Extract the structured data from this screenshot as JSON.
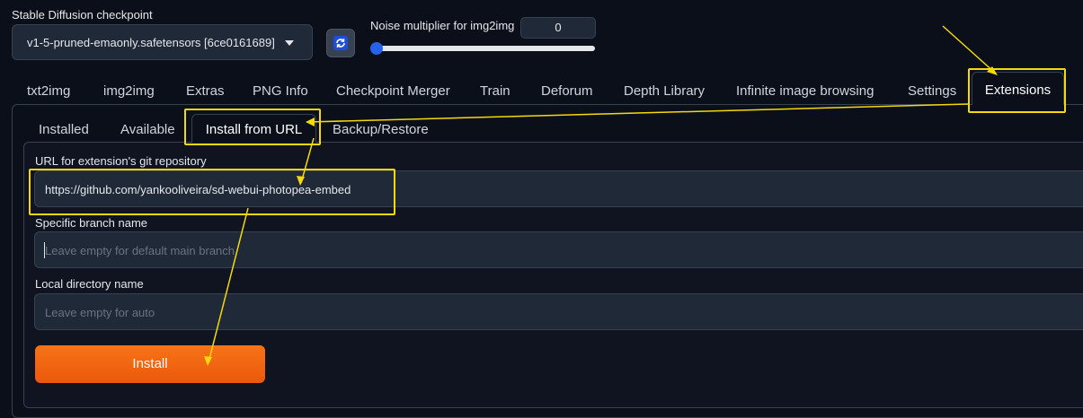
{
  "header": {
    "checkpoint_label": "Stable Diffusion checkpoint",
    "checkpoint_value": "v1-5-pruned-emaonly.safetensors [6ce0161689]",
    "refresh_icon": "refresh-icon",
    "noise_label": "Noise multiplier for img2img",
    "noise_value": "0",
    "noise_slider_fraction": 0
  },
  "tabs": [
    {
      "label": "txt2img"
    },
    {
      "label": "img2img"
    },
    {
      "label": "Extras"
    },
    {
      "label": "PNG Info"
    },
    {
      "label": "Checkpoint Merger"
    },
    {
      "label": "Train"
    },
    {
      "label": "Deforum"
    },
    {
      "label": "Depth Library"
    },
    {
      "label": "Infinite image browsing"
    },
    {
      "label": "Settings"
    },
    {
      "label": "Extensions",
      "active": true
    }
  ],
  "subtabs": [
    {
      "label": "Installed"
    },
    {
      "label": "Available"
    },
    {
      "label": "Install from URL",
      "active": true
    },
    {
      "label": "Backup/Restore"
    }
  ],
  "form": {
    "url_label": "URL for extension's git repository",
    "url_value": "https://github.com/yankooliveira/sd-webui-photopea-embed",
    "branch_label": "Specific branch name",
    "branch_placeholder": "Leave empty for default main branch",
    "dir_label": "Local directory name",
    "dir_placeholder": "Leave empty for auto",
    "install_label": "Install"
  },
  "colors": {
    "background": "#0b0f19",
    "highlight": "#f5d90a",
    "install_button": "#f97316",
    "slider_thumb": "#2563eb"
  }
}
